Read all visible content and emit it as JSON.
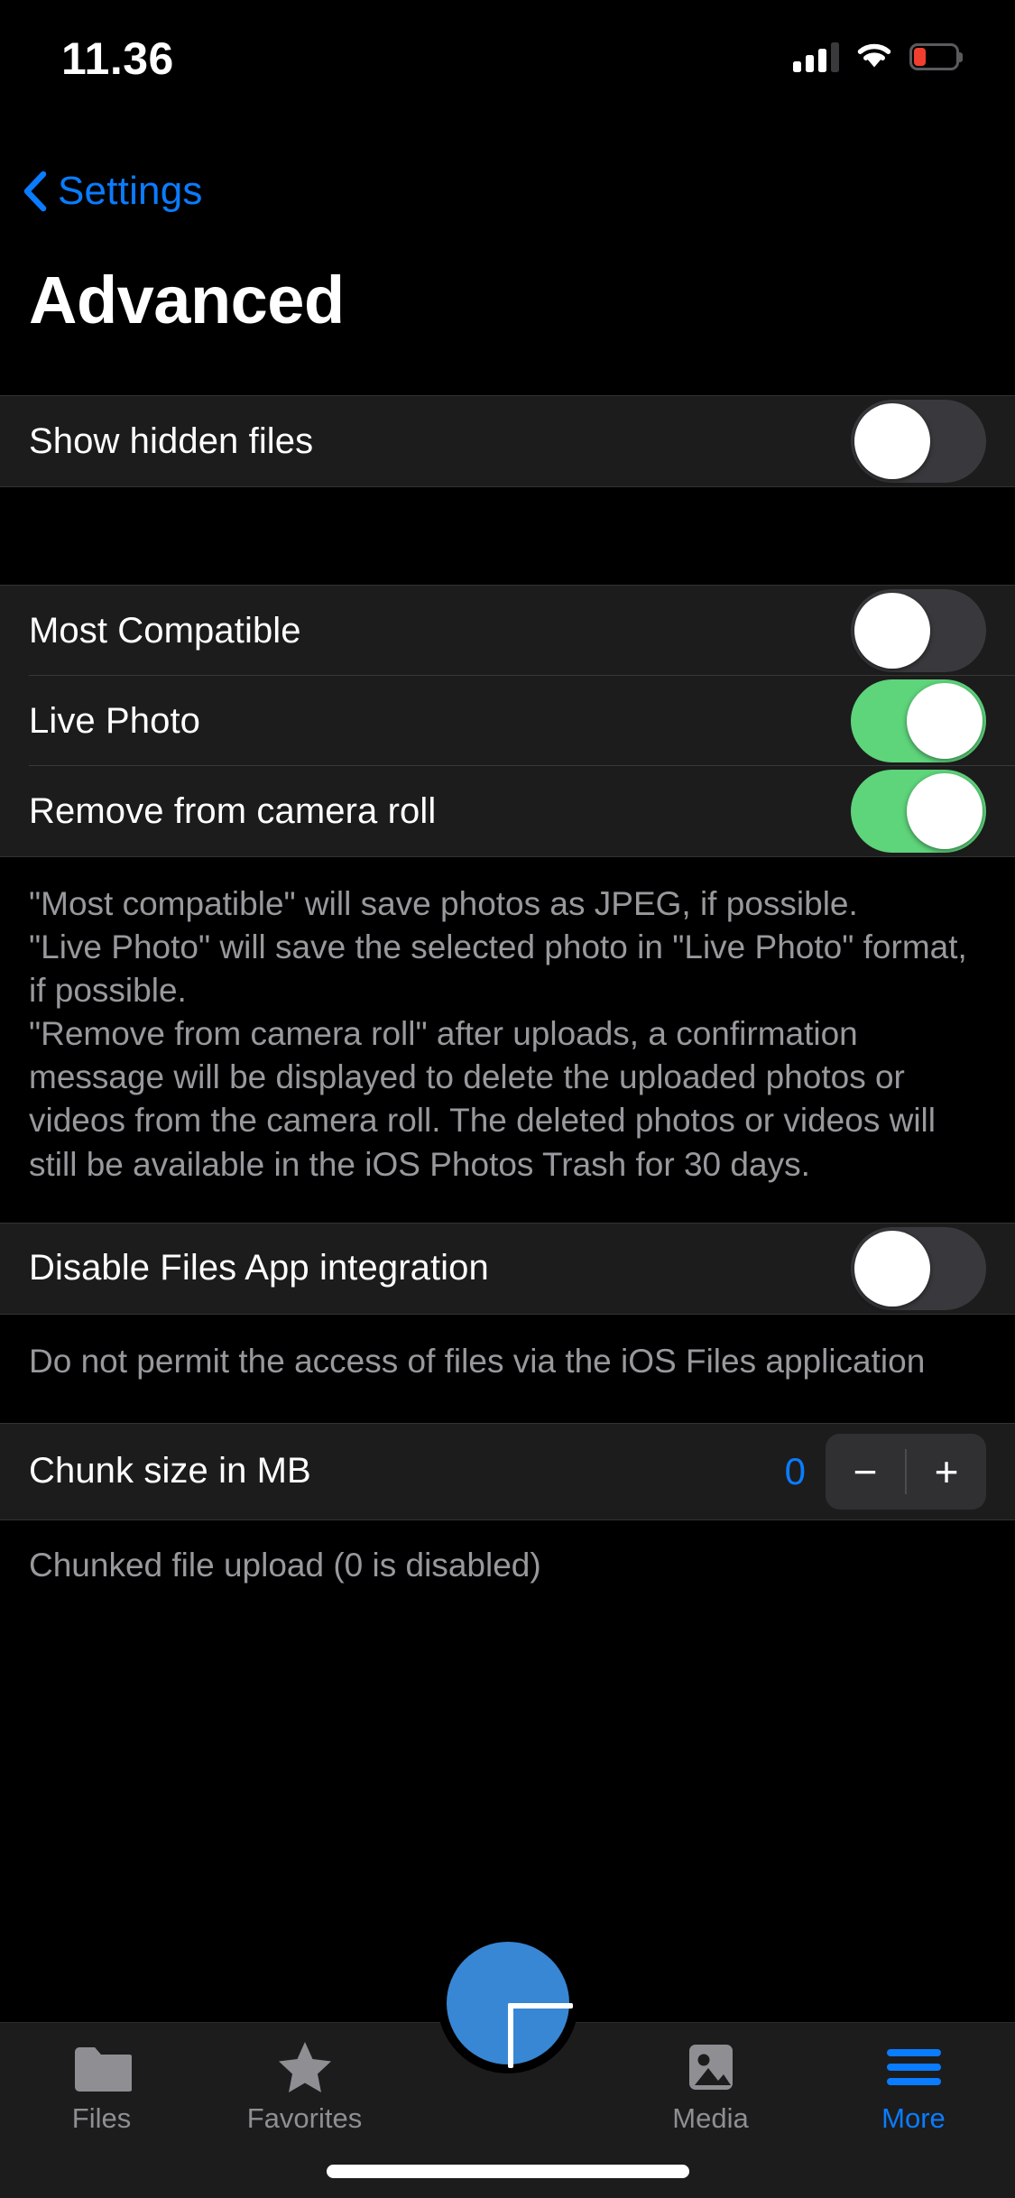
{
  "status_bar": {
    "time": "11.36",
    "signal_icon": "cellular-signal-icon",
    "wifi_icon": "wifi-icon",
    "battery_icon": "battery-low-icon",
    "battery_color": "#f03f2e"
  },
  "nav": {
    "back_label": "Settings",
    "back_icon": "chevron-left-icon",
    "title": "Advanced",
    "accent_color": "#0a7cff"
  },
  "sections": [
    {
      "rows": [
        {
          "label": "Show hidden files",
          "control": "toggle",
          "value": "off"
        }
      ],
      "footer": ""
    },
    {
      "rows": [
        {
          "label": "Most Compatible",
          "control": "toggle",
          "value": "off"
        },
        {
          "label": "Live Photo",
          "control": "toggle",
          "value": "on"
        },
        {
          "label": "Remove from camera roll",
          "control": "toggle",
          "value": "on"
        }
      ],
      "footer": "\"Most compatible\" will save photos as JPEG, if possible.\n\"Live Photo\" will save the selected photo in \"Live Photo\" format, if possible.\n\"Remove from camera roll\" after uploads, a confirmation message will be displayed to delete the uploaded photos or videos from the camera roll. The deleted photos or videos will still be available in the iOS Photos Trash for 30 days."
    },
    {
      "rows": [
        {
          "label": "Disable Files App integration",
          "control": "toggle",
          "value": "off"
        }
      ],
      "footer": "Do not permit the access of files via the iOS Files application"
    },
    {
      "rows": [
        {
          "label": "Chunk size in MB",
          "control": "stepper",
          "value": "0",
          "minus_label": "−",
          "plus_label": "+"
        }
      ],
      "footer": "Chunked file upload (0 is disabled)"
    }
  ],
  "toggle_colors": {
    "on": "#5ed47b",
    "off": "#39393d",
    "knob": "#ffffff"
  },
  "fab": {
    "icon": "plus-icon",
    "color": "#3787d4"
  },
  "tabbar": {
    "items": [
      {
        "label": "Files",
        "icon": "folder-icon",
        "active": false
      },
      {
        "label": "Favorites",
        "icon": "star-icon",
        "active": false
      },
      {
        "label": "",
        "icon": "",
        "active": false
      },
      {
        "label": "Media",
        "icon": "photo-icon",
        "active": false
      },
      {
        "label": "More",
        "icon": "hamburger-icon",
        "active": true
      }
    ]
  }
}
